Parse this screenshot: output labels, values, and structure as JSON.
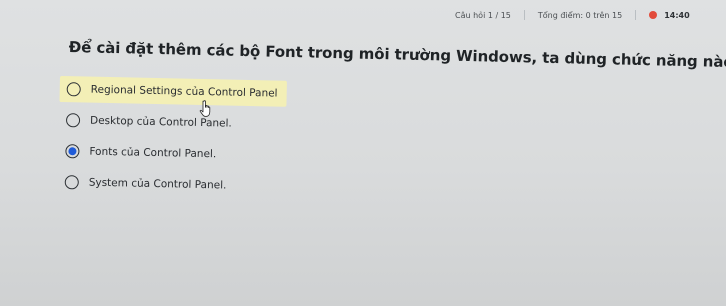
{
  "header": {
    "question_counter": "Câu hỏi 1 / 15",
    "score_text": "Tổng điểm: 0 trên 15",
    "timer": "14:40",
    "timer_color": "#e24b3b"
  },
  "question": {
    "text": "Để cài đặt thêm các bộ Font trong môi trường Windows, ta dùng chức năng nào?"
  },
  "options": [
    {
      "label": "Regional Settings của Control Panel",
      "selected": false,
      "highlighted": true
    },
    {
      "label": "Desktop của Control Panel.",
      "selected": false,
      "highlighted": false
    },
    {
      "label": "Fonts của Control Panel.",
      "selected": true,
      "highlighted": false
    },
    {
      "label": "System của Control Panel.",
      "selected": false,
      "highlighted": false
    }
  ],
  "colors": {
    "highlight": "#f3efb6",
    "radio_selected": "#1f5bd8"
  },
  "pointer": {
    "icon": "hand-pointer-icon"
  }
}
